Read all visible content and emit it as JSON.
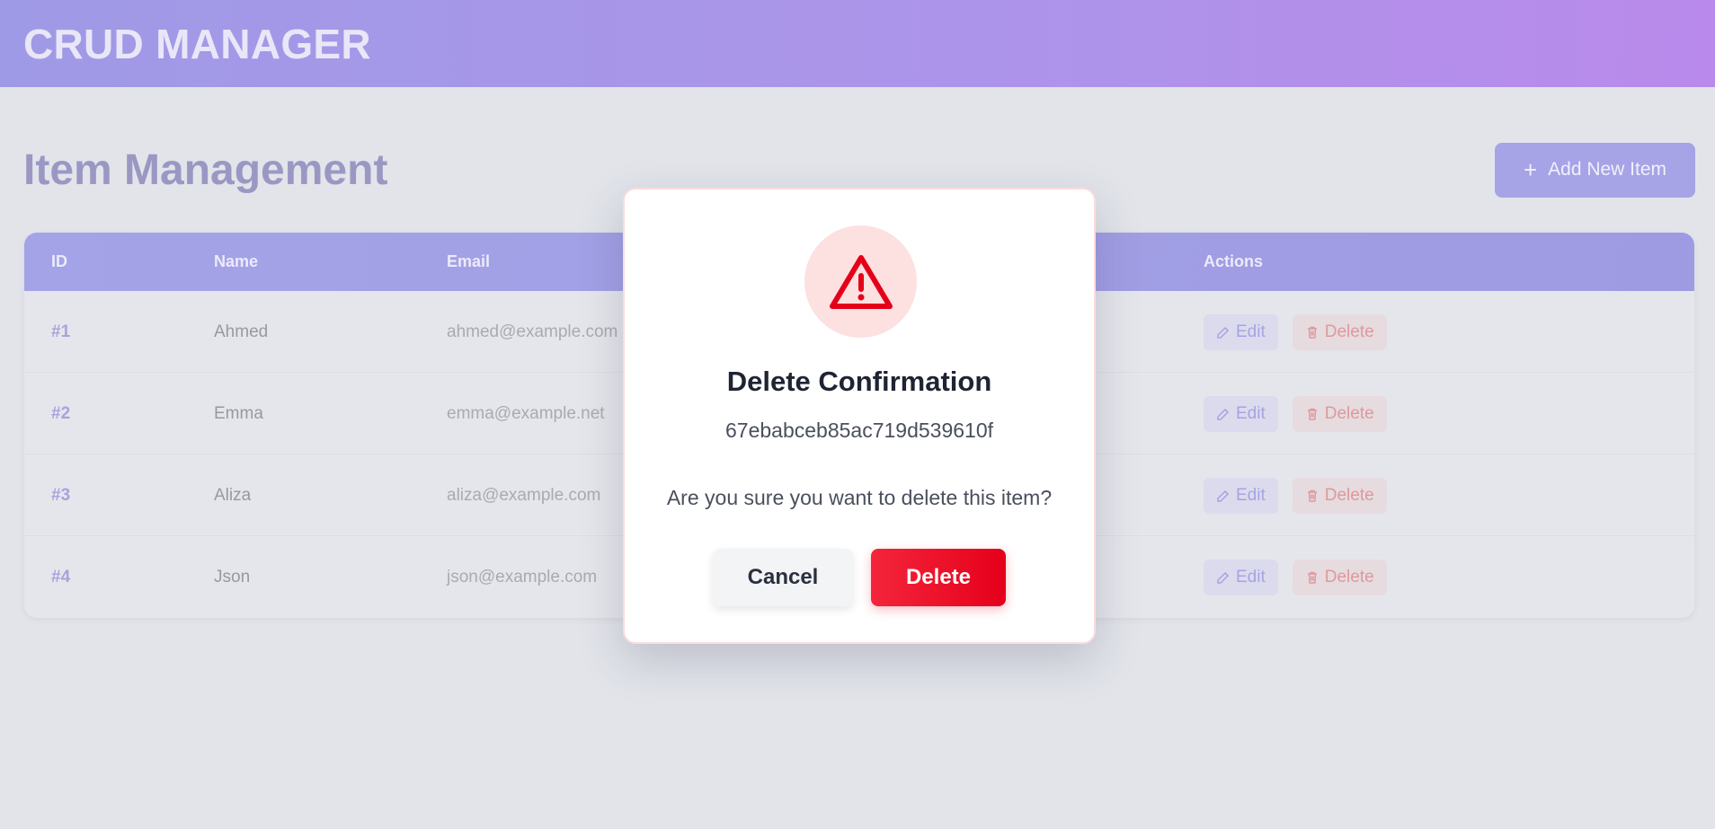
{
  "header": {
    "brand": "CRUD MANAGER"
  },
  "page": {
    "title": "Item Management",
    "add_button_label": "Add New Item"
  },
  "table": {
    "columns": {
      "id": "ID",
      "name": "Name",
      "email": "Email",
      "actions": "Actions"
    },
    "rows": [
      {
        "id": "#1",
        "name": "Ahmed",
        "email": "ahmed@example.com"
      },
      {
        "id": "#2",
        "name": "Emma",
        "email": "emma@example.net"
      },
      {
        "id": "#3",
        "name": "Aliza",
        "email": "aliza@example.com"
      },
      {
        "id": "#4",
        "name": "Json",
        "email": "json@example.com"
      }
    ],
    "edit_label": "Edit",
    "delete_label": "Delete"
  },
  "modal": {
    "title": "Delete Confirmation",
    "item_id": "67ebabceb85ac719d539610f",
    "message": "Are you sure you want to delete this item?",
    "cancel_label": "Cancel",
    "confirm_label": "Delete"
  },
  "colors": {
    "accent": "#a6a3e6",
    "danger": "#e5001a",
    "warning_bg": "#fde0e0"
  }
}
